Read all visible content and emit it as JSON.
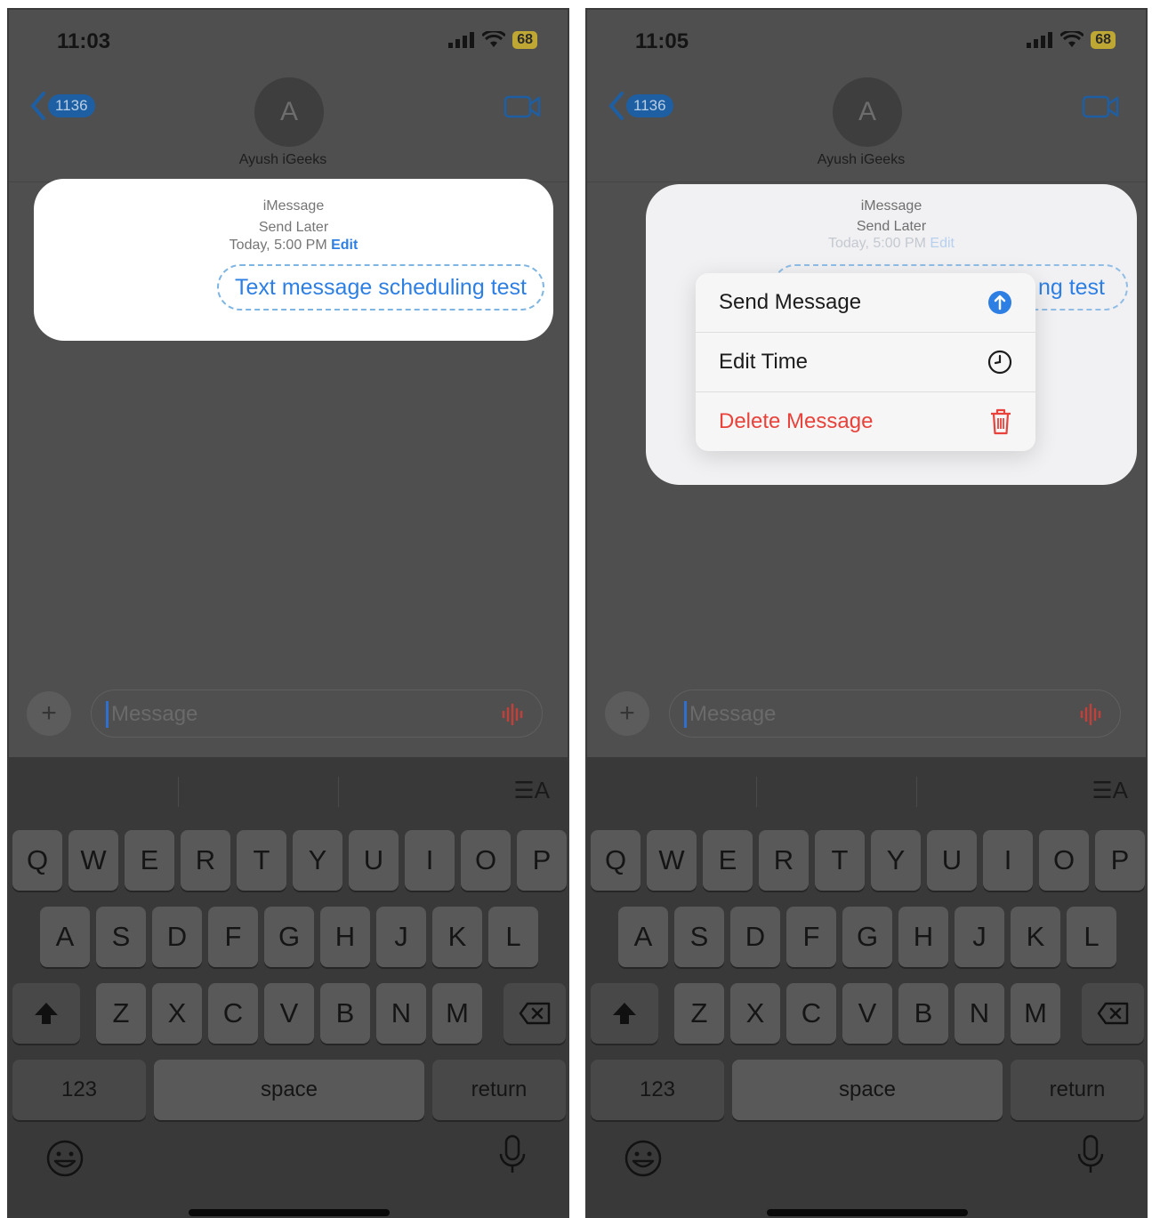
{
  "phones": [
    {
      "status": {
        "time": "11:03",
        "battery": "68"
      },
      "back_count": "1136",
      "contact": {
        "initial": "A",
        "name": "Ayush iGeeks"
      },
      "card": {
        "service": "iMessage",
        "send_later": "Send Later",
        "schedule_time": "Today, 5:00 PM",
        "edit": "Edit",
        "message": "Text message scheduling test"
      },
      "input_placeholder": "Message"
    },
    {
      "status": {
        "time": "11:05",
        "battery": "68"
      },
      "back_count": "1136",
      "contact": {
        "initial": "A",
        "name": "Ayush iGeeks"
      },
      "card": {
        "service": "iMessage",
        "send_later": "Send Later",
        "schedule_time": "Today, 5:00 PM",
        "edit": "Edit",
        "message_visible": "ng test"
      },
      "context_menu": [
        {
          "label": "Send Message",
          "icon": "arrow-up-circle-icon"
        },
        {
          "label": "Edit Time",
          "icon": "clock-icon"
        },
        {
          "label": "Delete Message",
          "icon": "trash-icon"
        }
      ],
      "input_placeholder": "Message"
    }
  ],
  "keyboard": {
    "row1": [
      "Q",
      "W",
      "E",
      "R",
      "T",
      "Y",
      "U",
      "I",
      "O",
      "P"
    ],
    "row2": [
      "A",
      "S",
      "D",
      "F",
      "G",
      "H",
      "J",
      "K",
      "L"
    ],
    "row3": [
      "Z",
      "X",
      "C",
      "V",
      "B",
      "N",
      "M"
    ],
    "numbers_key": "123",
    "space_key": "space",
    "return_key": "return"
  },
  "colors": {
    "accent": "#2d7fe3",
    "destructive": "#e8423b",
    "dimmed_background": "#4f4f4f",
    "keyboard_background": "#393939"
  }
}
